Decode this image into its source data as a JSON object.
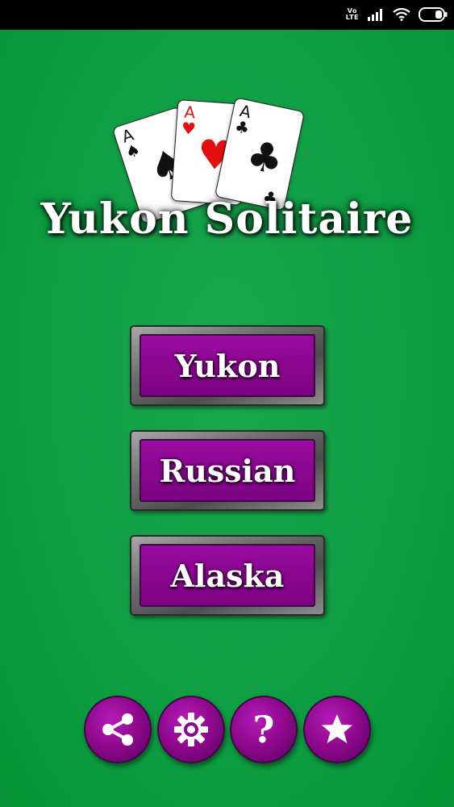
{
  "status_bar": {
    "volte_line1": "Vo",
    "volte_line2": "LTE",
    "icons": [
      "volte-icon",
      "signal-icon",
      "wifi-icon",
      "battery-icon"
    ]
  },
  "cards": [
    {
      "rank": "A",
      "suit": "♠",
      "suit_name": "spades",
      "color": "#111111"
    },
    {
      "rank": "A",
      "suit": "♥",
      "suit_name": "hearts",
      "color": "#e3100e"
    },
    {
      "rank": "A",
      "suit": "♣",
      "suit_name": "clubs",
      "color": "#111111"
    }
  ],
  "title": "Yukon Solitaire",
  "menu": {
    "buttons": [
      {
        "label": "Yukon"
      },
      {
        "label": "Russian"
      },
      {
        "label": "Alaska"
      }
    ]
  },
  "bottom_bar": {
    "buttons": [
      {
        "icon": "share-icon"
      },
      {
        "icon": "gear-icon"
      },
      {
        "icon": "help-icon",
        "glyph": "?"
      },
      {
        "icon": "star-icon"
      }
    ]
  },
  "colors": {
    "background": "#12a047",
    "button_face": "#8a0690",
    "button_frame": "#6e6e6e",
    "text": "#ffffff"
  }
}
